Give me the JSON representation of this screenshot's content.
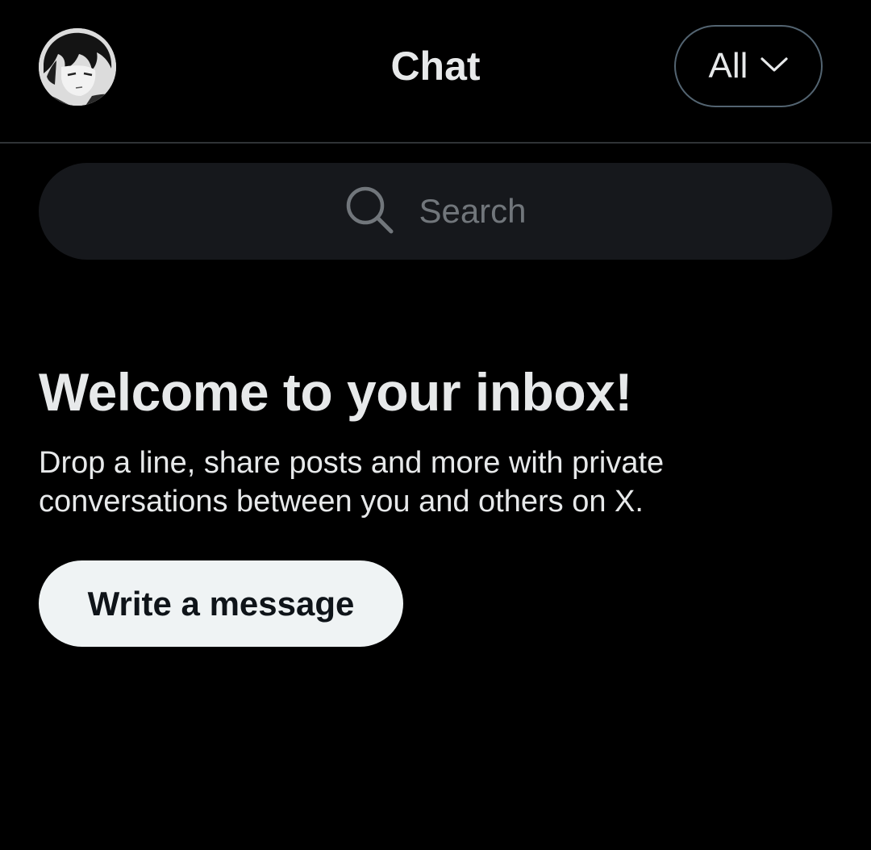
{
  "header": {
    "title": "Chat",
    "filter_label": "All",
    "avatar_icon": "user-avatar"
  },
  "search": {
    "placeholder": "Search",
    "icon": "search-icon"
  },
  "empty_state": {
    "title": "Welcome to your inbox!",
    "description": "Drop a line, share posts and more with private conversations between you and others on X.",
    "cta_label": "Write a message"
  },
  "colors": {
    "background": "#000000",
    "text_primary": "#e7e9ea",
    "text_secondary": "#71767b",
    "search_bg": "#16181c",
    "border": "#2f3336",
    "cta_bg": "#eff3f4",
    "cta_text": "#0f1419"
  }
}
